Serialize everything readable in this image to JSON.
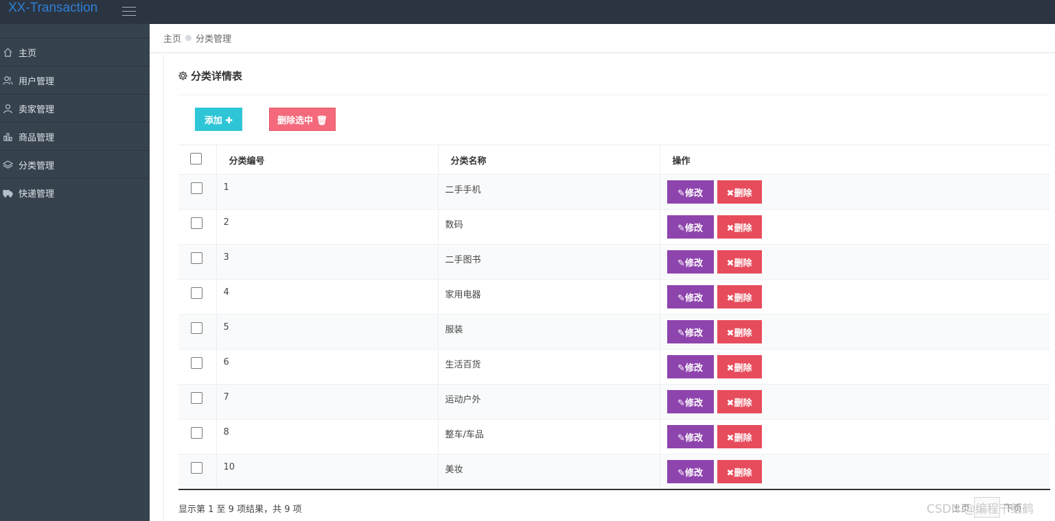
{
  "app": {
    "brand": "XX-Transaction"
  },
  "sidebar": {
    "items": [
      {
        "label": "主页",
        "icon": "home-icon"
      },
      {
        "label": "用户管理",
        "icon": "users-icon"
      },
      {
        "label": "卖家管理",
        "icon": "user-icon"
      },
      {
        "label": "商品管理",
        "icon": "bar-chart-icon"
      },
      {
        "label": "分类管理",
        "icon": "layers-icon"
      },
      {
        "label": "快递管理",
        "icon": "truck-icon"
      }
    ]
  },
  "breadcrumb": {
    "home": "主页",
    "current": "分类管理"
  },
  "panel": {
    "title": "分类详情表",
    "add_label": "添加 ✚",
    "delete_selected_label": "删除选中 🗑"
  },
  "table": {
    "headers": {
      "id": "分类编号",
      "name": "分类名称",
      "actions": "操作"
    },
    "edit_label": "✎修改",
    "delete_label": "✖删除",
    "rows": [
      {
        "id": "1",
        "name": "二手手机"
      },
      {
        "id": "2",
        "name": "数码"
      },
      {
        "id": "3",
        "name": "二手图书"
      },
      {
        "id": "4",
        "name": "家用电器"
      },
      {
        "id": "5",
        "name": "服装"
      },
      {
        "id": "6",
        "name": "生活百货"
      },
      {
        "id": "7",
        "name": "运动户外"
      },
      {
        "id": "8",
        "name": "整车/车品"
      },
      {
        "id": "10",
        "name": "美妆"
      }
    ]
  },
  "footer": {
    "info": "显示第 1 至 9 项结果，共 9 项",
    "prev": "上页",
    "next": "下页"
  },
  "watermark": "CSDN @编程千纸鹤",
  "colors": {
    "topbar": "#2b3541",
    "sidebar": "#37424f",
    "brand": "#2f7fd6",
    "add": "#2ec6d6",
    "delete_selected": "#f46a7c",
    "edit": "#8e44ad",
    "delete": "#e74c5c"
  }
}
